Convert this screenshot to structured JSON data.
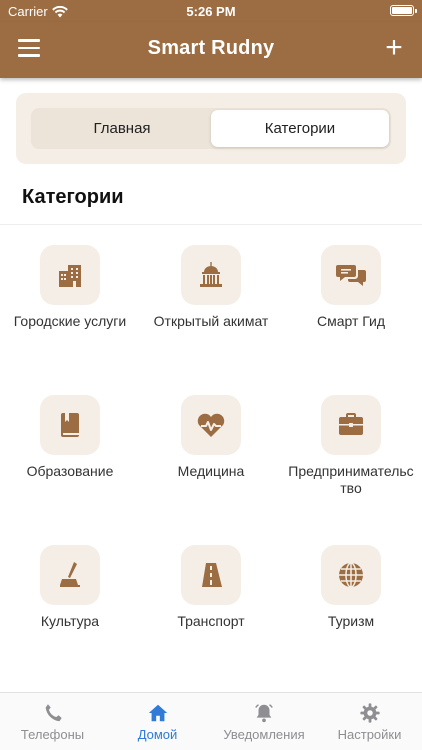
{
  "status_bar": {
    "carrier": "Carrier",
    "time": "5:26 PM"
  },
  "header": {
    "title": "Smart Rudny"
  },
  "segment": {
    "tabs": [
      "Главная",
      "Категории"
    ],
    "selected": "Категории"
  },
  "section": {
    "title": "Категории"
  },
  "categories": [
    {
      "label": "Городские услуги",
      "icon": "city-buildings-icon"
    },
    {
      "label": "Открытый акимат",
      "icon": "capitol-building-icon"
    },
    {
      "label": "Смарт Гид",
      "icon": "chat-bubbles-icon"
    },
    {
      "label": "Образование",
      "icon": "book-icon"
    },
    {
      "label": "Медицина",
      "icon": "heart-pulse-icon"
    },
    {
      "label": "Предпринимательство",
      "icon": "briefcase-icon"
    },
    {
      "label": "Культура",
      "icon": "pen-in-inkwell-icon"
    },
    {
      "label": "Транспорт",
      "icon": "road-icon"
    },
    {
      "label": "Туризм",
      "icon": "globe-icon"
    }
  ],
  "tabbar": {
    "items": [
      {
        "label": "Телефоны",
        "icon": "phone-icon"
      },
      {
        "label": "Домой",
        "icon": "home-icon"
      },
      {
        "label": "Уведомления",
        "icon": "bell-icon"
      },
      {
        "label": "Настройки",
        "icon": "gear-icon"
      }
    ],
    "active": "Домой"
  },
  "colors": {
    "brand": "#9c6d43",
    "icon_bg": "#f4eee6",
    "active_tab": "#2f7bd6",
    "inactive_tab": "#8e8e93"
  }
}
